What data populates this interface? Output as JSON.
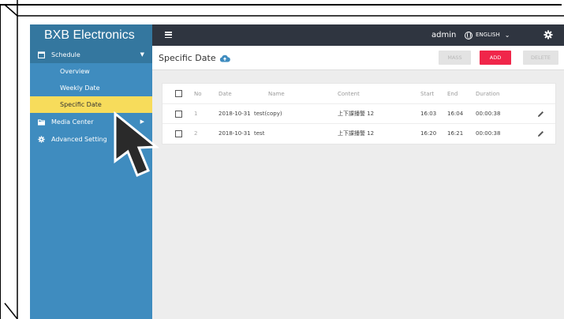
{
  "brand": "BXB Electronics",
  "sidebar": {
    "groups": [
      {
        "label": "Schedule",
        "icon": "calendar-icon",
        "caret": "▼"
      },
      {
        "label": "Media Center",
        "icon": "folder-icon",
        "caret": "▶"
      },
      {
        "label": "Advanced Setting",
        "icon": "gear-icon"
      }
    ],
    "schedule_items": [
      "Overview",
      "Weekly Date",
      "Specific Date"
    ],
    "active_item": "Specific Date"
  },
  "topbar": {
    "menu_icon": "hamburger-icon",
    "user": "admin",
    "language": "ENGLISH",
    "settings_icon": "gear-icon"
  },
  "page": {
    "title": "Specific Date",
    "title_icon": "cloud-upload-icon",
    "buttons": {
      "mass": "MASS",
      "add": "ADD",
      "delete": "DELETE"
    }
  },
  "table": {
    "columns": [
      "No",
      "Date",
      "Name",
      "Content",
      "Start",
      "End",
      "Duration"
    ],
    "rows": [
      {
        "no": "1",
        "date": "2018-10-31",
        "name": "test(copy)",
        "content": "上下課播警 12",
        "start": "16:03",
        "end": "16:04",
        "duration": "00:00:38"
      },
      {
        "no": "2",
        "date": "2018-10-31",
        "name": "test",
        "content": "上下課播警 12",
        "start": "16:20",
        "end": "16:21",
        "duration": "00:00:38"
      }
    ]
  },
  "colors": {
    "sidebar": "#3f8cbf",
    "sidebar_dark": "#34779f",
    "active_item": "#f7dc5b",
    "topbar": "#2f3540",
    "add_button": "#f0264a"
  }
}
